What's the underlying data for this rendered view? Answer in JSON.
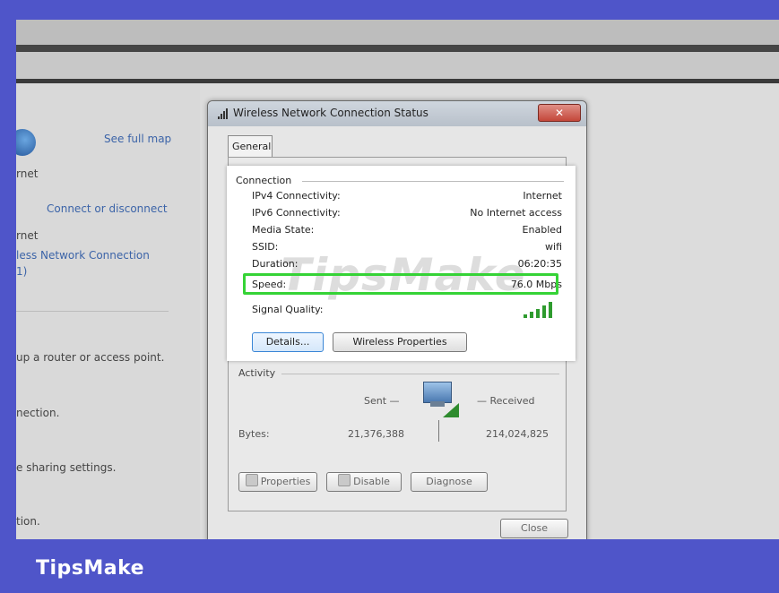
{
  "left_pane": {
    "see_full_map": "See full map",
    "internet_label": "rnet",
    "connect_or_disconnect": "Connect or disconnect",
    "network_type": "rnet",
    "connection_name": "less Network Connection",
    "connection_index": "1)",
    "setup_router": "up a router or access point.",
    "connection_item": "nection.",
    "sharing_settings": "e sharing settings.",
    "last_item": "tion."
  },
  "dialog": {
    "title": "Wireless Network Connection Status",
    "close_glyph": "✕",
    "tab_general": "General",
    "connection_group": "Connection",
    "rows": [
      {
        "key": "IPv4 Connectivity:",
        "value": "Internet"
      },
      {
        "key": "IPv6 Connectivity:",
        "value": "No Internet access"
      },
      {
        "key": "Media State:",
        "value": "Enabled"
      },
      {
        "key": "SSID:",
        "value": "wifi"
      },
      {
        "key": "Duration:",
        "value": "06:20:35"
      },
      {
        "key": "Speed:",
        "value": "76.0 Mbps"
      }
    ],
    "signal_quality_label": "Signal Quality:",
    "signal_bars": 5,
    "details_button": "Details...",
    "wireless_properties_button": "Wireless Properties",
    "activity_group": "Activity",
    "sent_label": "Sent —",
    "received_label": "— Received",
    "bytes_label": "Bytes:",
    "bytes_sent": "21,376,388",
    "bytes_received": "214,024,825",
    "properties_button": "Properties",
    "disable_button": "Disable",
    "diagnose_button": "Diagnose",
    "close_button": "Close"
  },
  "watermark": "TipsMake",
  "footer": {
    "brand": "TipsMake"
  },
  "colors": {
    "frame": "#4f55c9",
    "highlight": "#35d336",
    "link": "#3c64a8"
  },
  "icons": [
    "globe-icon",
    "wifi-signal-icon",
    "network-computer-icon",
    "shield-icon"
  ]
}
